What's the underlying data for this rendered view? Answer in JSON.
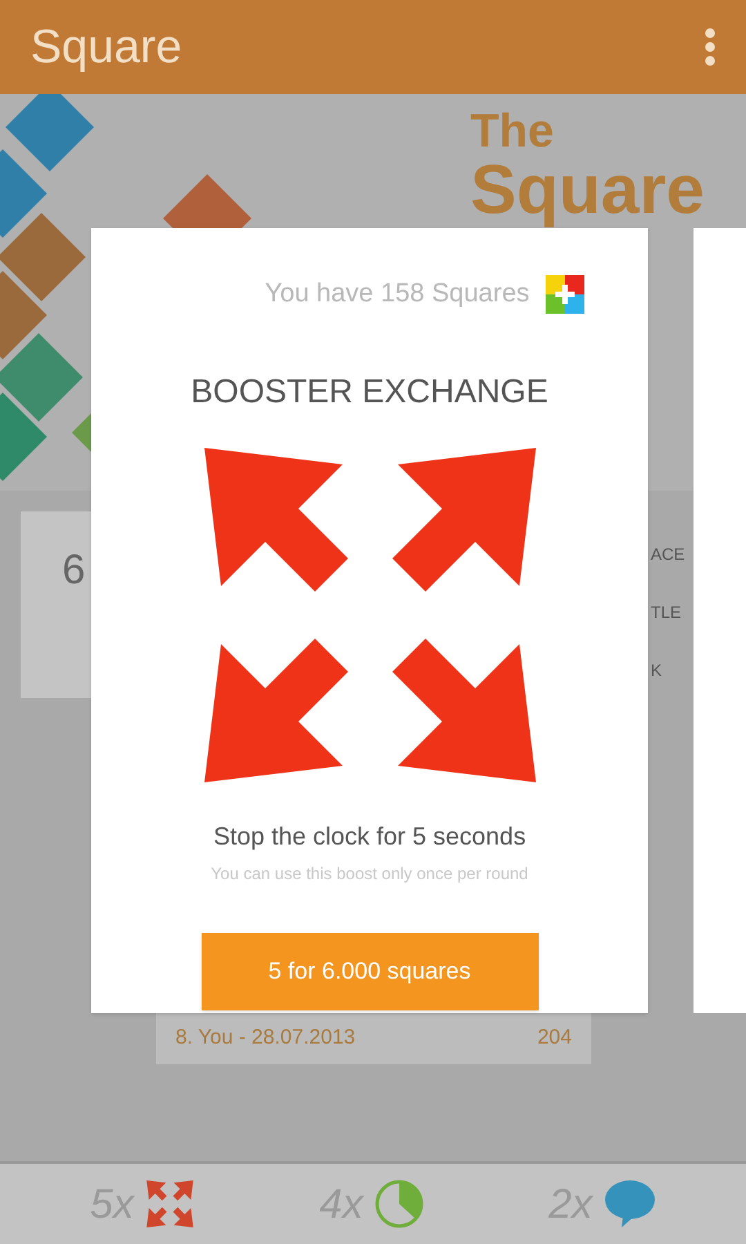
{
  "app_bar": {
    "title": "Square"
  },
  "background": {
    "logo": [
      "The",
      "Square"
    ],
    "score_card": "6",
    "side_labels": [
      "ACE",
      "TLE",
      "K"
    ],
    "leaderboard_row": {
      "rank": "8.",
      "name": "You - 28.07.2013",
      "score": "204"
    }
  },
  "dialog": {
    "balance": "You have 158 Squares",
    "title": "BOOSTER EXCHANGE",
    "description": "Stop the clock for 5 seconds",
    "note": "You can use this boost only once per round",
    "buy_button": "5 for 6.000 squares"
  },
  "boosters": [
    {
      "kind": "expand",
      "count": "5x"
    },
    {
      "kind": "clock",
      "count": "4x"
    },
    {
      "kind": "hint",
      "count": "2x"
    }
  ]
}
